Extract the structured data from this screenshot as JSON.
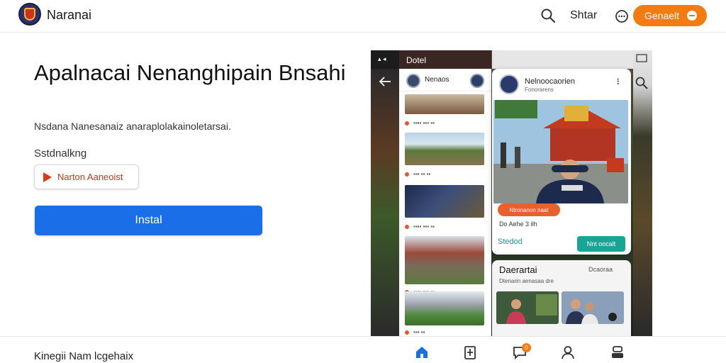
{
  "header": {
    "brand": "Naranai",
    "share_label": "Shtar",
    "cta_label": "Genaelt"
  },
  "hero": {
    "title": "Apalnacai Nenanghipain Bnsahi",
    "subtitle": "Nsdana Nanesanaiz anaraplolakainoletarsai.",
    "section_label": "Sstdnalkng",
    "source_label": "Narton Aaneoist",
    "install_label": "Instal"
  },
  "footer": {
    "text": "Kinegii Nam lcgehaix",
    "notification_count": "0"
  },
  "preview": {
    "feed_header": "Dotel",
    "feed_user": "Nenaos",
    "post_user": "Nelnoocaorien",
    "post_sub": "Fonorarens",
    "post_tag": "Ntronanon naat",
    "post_row": "Do Aehe 3 ilh",
    "post_action": "Stedod",
    "post_action2": "Nnt oocalt",
    "section_title": "Daerartai",
    "section_meta": "Dcaoraa",
    "section_sub": "Dtenarin aenasaa dre"
  },
  "colors": {
    "accent_orange": "#f47b0f",
    "primary_blue": "#1a6fe8",
    "teal": "#1aa496"
  }
}
